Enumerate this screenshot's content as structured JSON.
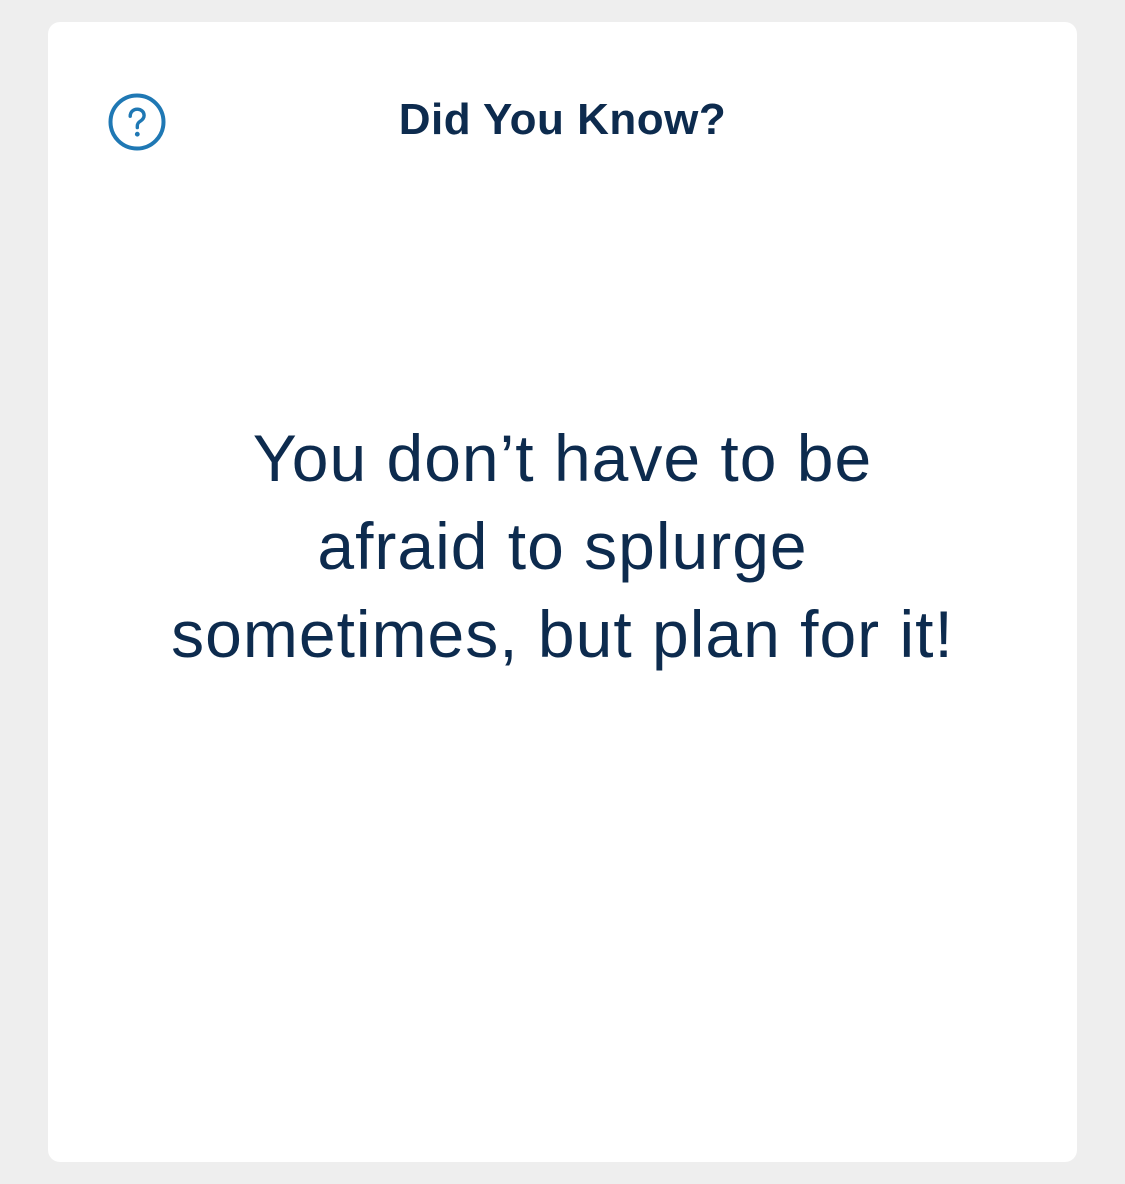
{
  "card": {
    "title": "Did You Know?",
    "help_icon": "question-circle-icon",
    "tip": "You don’t have to be afraid to splurge sometimes, but plan for it!"
  },
  "colors": {
    "background": "#eeeeee",
    "card": "#ffffff",
    "title_text": "#0d2b4e",
    "icon_accent": "#1f78b4"
  }
}
